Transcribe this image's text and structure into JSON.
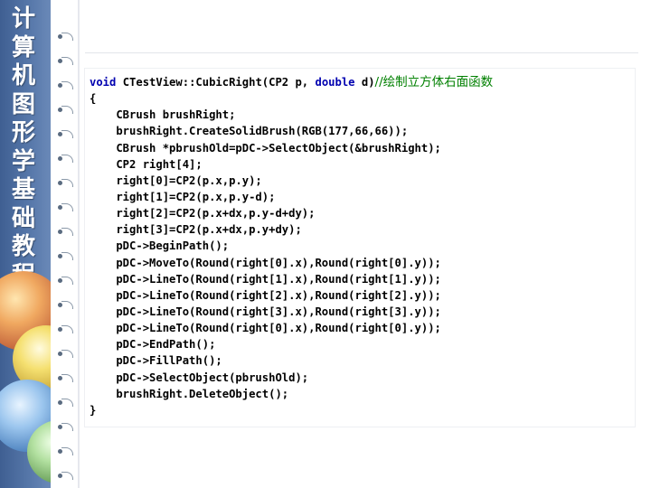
{
  "sidebar": {
    "title_chars": [
      "计",
      "算",
      "机",
      "图",
      "形",
      "学",
      "基",
      "础",
      "教",
      "程"
    ]
  },
  "code": {
    "lines": [
      {
        "parts": [
          {
            "t": "void",
            "k": "kw"
          },
          {
            "t": " CTestView::CubicRight(CP2 p, "
          },
          {
            "t": "double",
            "k": "kw"
          },
          {
            "t": " d)"
          },
          {
            "t": "//绘制立方体右面函数",
            "k": "cm"
          }
        ]
      },
      {
        "parts": [
          {
            "t": "{"
          }
        ]
      },
      {
        "parts": [
          {
            "t": "    CBrush brushRight;"
          }
        ]
      },
      {
        "parts": [
          {
            "t": "    brushRight.CreateSolidBrush(RGB(177,66,66));"
          }
        ]
      },
      {
        "parts": [
          {
            "t": "    CBrush *pbrushOld=pDC->SelectObject(&brushRight);"
          }
        ]
      },
      {
        "parts": [
          {
            "t": "    CP2 right[4];"
          }
        ]
      },
      {
        "parts": [
          {
            "t": "    right[0]=CP2(p.x,p.y);"
          }
        ]
      },
      {
        "parts": [
          {
            "t": "    right[1]=CP2(p.x,p.y-d);"
          }
        ]
      },
      {
        "parts": [
          {
            "t": "    right[2]=CP2(p.x+dx,p.y-d+dy);"
          }
        ]
      },
      {
        "parts": [
          {
            "t": "    right[3]=CP2(p.x+dx,p.y+dy);"
          }
        ]
      },
      {
        "parts": [
          {
            "t": "    pDC->BeginPath();"
          }
        ]
      },
      {
        "parts": [
          {
            "t": "    pDC->MoveTo(Round(right[0].x),Round(right[0].y));"
          }
        ]
      },
      {
        "parts": [
          {
            "t": "    pDC->LineTo(Round(right[1].x),Round(right[1].y));"
          }
        ]
      },
      {
        "parts": [
          {
            "t": "    pDC->LineTo(Round(right[2].x),Round(right[2].y));"
          }
        ]
      },
      {
        "parts": [
          {
            "t": "    pDC->LineTo(Round(right[3].x),Round(right[3].y));"
          }
        ]
      },
      {
        "parts": [
          {
            "t": "    pDC->LineTo(Round(right[0].x),Round(right[0].y));"
          }
        ]
      },
      {
        "parts": [
          {
            "t": "    pDC->EndPath();"
          }
        ]
      },
      {
        "parts": [
          {
            "t": "    pDC->FillPath();"
          }
        ]
      },
      {
        "parts": [
          {
            "t": "    pDC->SelectObject(pbrushOld);"
          }
        ]
      },
      {
        "parts": [
          {
            "t": "    brushRight.DeleteObject();"
          }
        ]
      },
      {
        "parts": [
          {
            "t": "}"
          }
        ]
      }
    ]
  },
  "colors": {
    "keyword": "#0000b0",
    "comment": "#008000",
    "code_text": "#000000",
    "sidebar": "#4a6a9e"
  }
}
